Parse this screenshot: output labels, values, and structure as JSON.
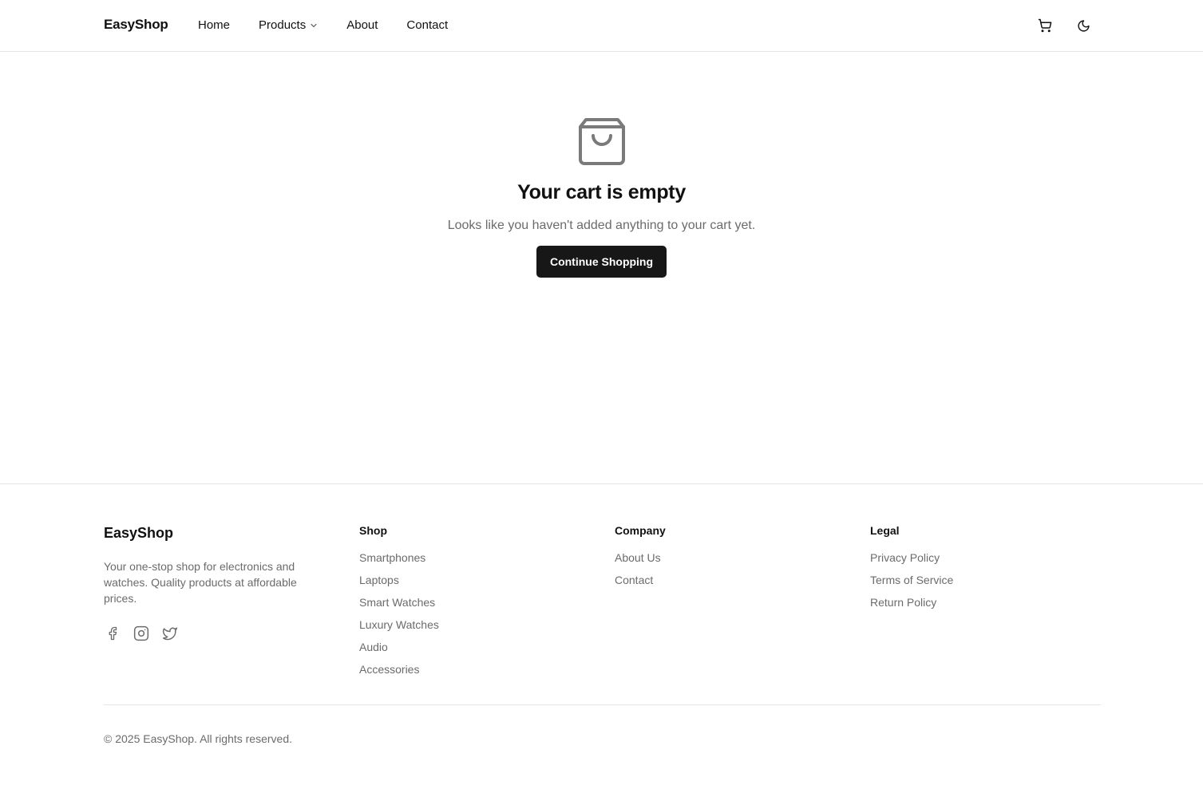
{
  "header": {
    "brand": "EasyShop",
    "nav": [
      {
        "label": "Home"
      },
      {
        "label": "Products"
      },
      {
        "label": "About"
      },
      {
        "label": "Contact"
      }
    ],
    "icons": [
      "cart-icon",
      "moon-icon",
      "chevron-down-icon"
    ]
  },
  "empty_cart": {
    "icon": "shopping-bag-icon",
    "title": "Your cart is empty",
    "subtitle": "Looks like you haven't added anything to your cart yet.",
    "button_label": "Continue Shopping"
  },
  "footer": {
    "brand": "EasyShop",
    "description": "Your one-stop shop for electronics and watches. Quality products at affordable prices.",
    "social_icons": [
      "facebook-icon",
      "instagram-icon",
      "twitter-icon"
    ],
    "columns": [
      {
        "title": "Shop",
        "links": [
          "Smartphones",
          "Laptops",
          "Smart Watches",
          "Luxury Watches",
          "Audio",
          "Accessories"
        ]
      },
      {
        "title": "Company",
        "links": [
          "About Us",
          "Contact"
        ]
      },
      {
        "title": "Legal",
        "links": [
          "Privacy Policy",
          "Terms of Service",
          "Return Policy"
        ]
      }
    ],
    "copyright": "© 2025 EasyShop. All rights reserved."
  },
  "colors": {
    "primary_button": "#171717",
    "text": "#111111",
    "muted_text": "#6b6b6b",
    "border": "#e5e5e5",
    "icon_gray": "#7a7a7a"
  }
}
